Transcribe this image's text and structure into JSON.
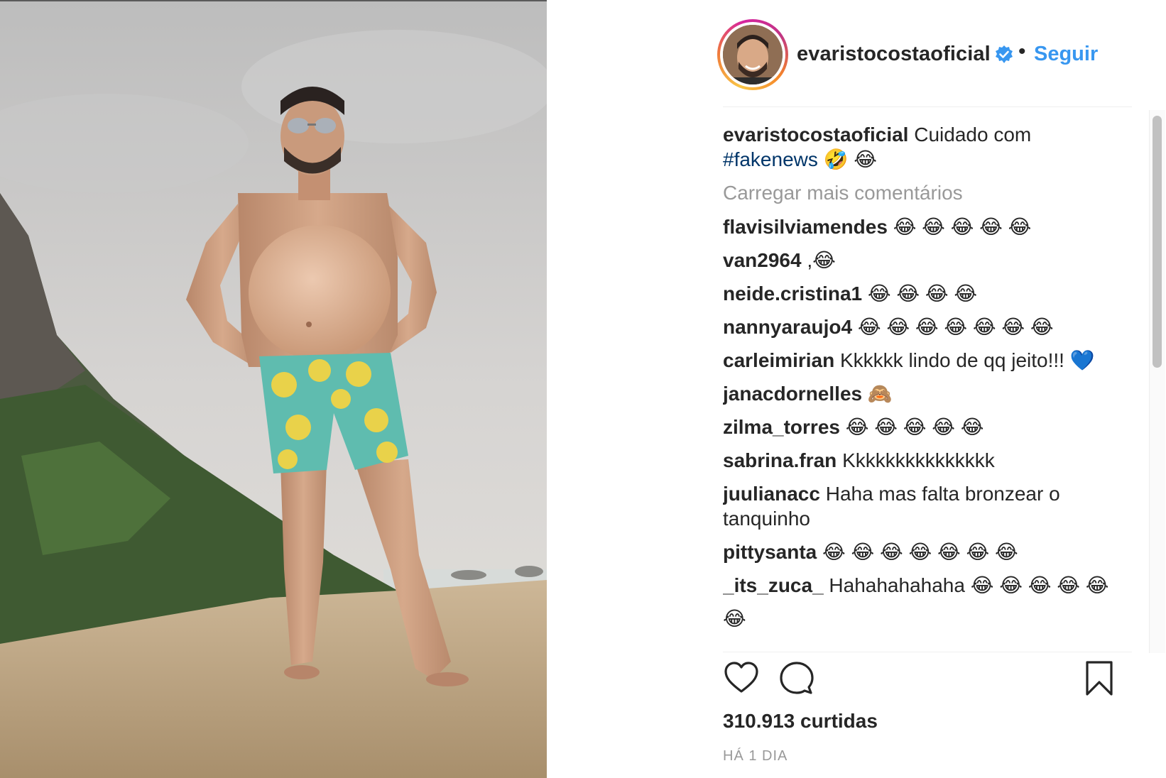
{
  "post": {
    "author": "evaristocostaoficial",
    "follow_label": "Seguir",
    "separator": "•",
    "caption_text": "Cuidado com",
    "caption_hashtag": "#fakenews",
    "caption_emojis": "🤣 😂",
    "load_more": "Carregar mais comentários",
    "likes": "310.913 curtidas",
    "time": "HÁ 1 DIA"
  },
  "comments": [
    {
      "user": "flavisilviamendes",
      "text": "😂 😂 😂 😂 😂"
    },
    {
      "user": "van2964",
      "text": ",😂"
    },
    {
      "user": "neide.cristina1",
      "text": "😂 😂 😂 😂"
    },
    {
      "user": "nannyaraujo4",
      "text": "😂 😂 😂 😂 😂 😂 😂"
    },
    {
      "user": "carleimirian",
      "text": "Kkkkkk lindo de qq jeito!!! 💙"
    },
    {
      "user": "janacdornelles",
      "text": "🙈"
    },
    {
      "user": "zilma_torres",
      "text": "😂 😂 😂 😂 😂"
    },
    {
      "user": "sabrina.fran",
      "text": "Kkkkkkkkkkkkkkk"
    },
    {
      "user": "juulianacc",
      "text": "Haha mas falta bronzear o tanquinho"
    },
    {
      "user": "pittysanta",
      "text": "😂 😂 😂 😂 😂 😂 😂"
    },
    {
      "user": "_its_zuca_",
      "text": "Hahahahahaha 😂 😂 😂 😂 😂"
    },
    {
      "user": "",
      "text": "😂"
    }
  ],
  "icons": {
    "like": "heart-icon",
    "comment": "comment-bubble-icon",
    "save": "bookmark-icon",
    "verified": "verified-badge-icon"
  },
  "colors": {
    "link_blue": "#3897f0",
    "hashtag": "#003569",
    "muted": "#999999",
    "text": "#262626"
  }
}
